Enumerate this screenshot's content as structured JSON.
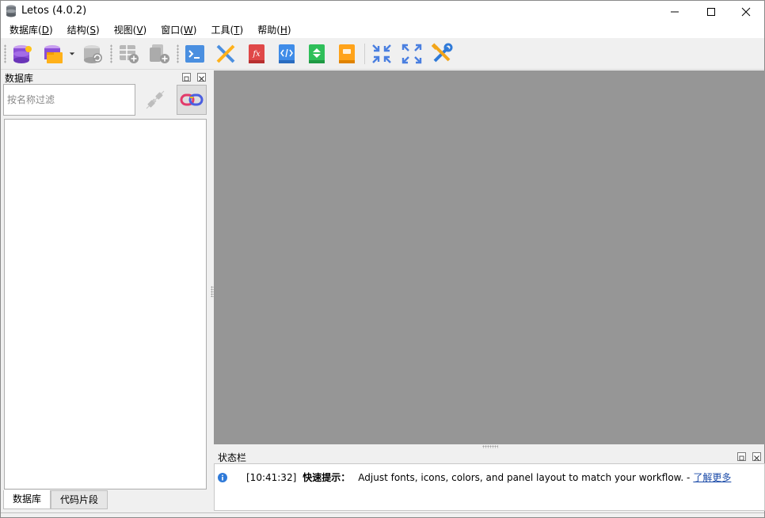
{
  "window": {
    "title": "Letos (4.0.2)",
    "minimize_glyph": "—",
    "maximize_glyph": "☐",
    "close_glyph": "✕"
  },
  "menu": [
    {
      "label": "数据库(",
      "accel": "D",
      "end": ")"
    },
    {
      "label": "结构(",
      "accel": "S",
      "end": ")"
    },
    {
      "label": "视图(",
      "accel": "V",
      "end": ")"
    },
    {
      "label": "窗口(",
      "accel": "W",
      "end": ")"
    },
    {
      "label": "工具(",
      "accel": "T",
      "end": ")"
    },
    {
      "label": "帮助(",
      "accel": "H",
      "end": ")"
    }
  ],
  "toolbar": {
    "icons": [
      "add-database-icon",
      "open-database-icon",
      "dropdown-arrow-icon",
      "refresh-database-icon",
      "create-table-icon",
      "create-index-icon",
      "sql-editor-icon",
      "design-icon",
      "function-icon",
      "code-editor-icon",
      "export-book-icon",
      "import-book-icon",
      "collapse-icon",
      "expand-icon",
      "settings-tools-icon"
    ]
  },
  "left_dock": {
    "title": "数据库",
    "filter_placeholder": "按名称过滤",
    "tabs": [
      "数据库",
      "代码片段"
    ]
  },
  "status_dock": {
    "title": "状态栏",
    "time": "[10:41:32]",
    "label": "快速提示：",
    "message": "Adjust fonts, icons, colors, and panel layout to match your workflow. -",
    "link": "了解更多"
  },
  "colors": {
    "mdi_background": "#969696",
    "link": "#1a4aa8",
    "info_blue": "#2f7ad8"
  }
}
